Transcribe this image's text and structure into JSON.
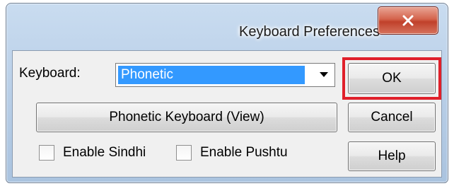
{
  "window": {
    "title": "Keyboard Preferences"
  },
  "keyboard": {
    "label": "Keyboard:",
    "selected": "Phonetic"
  },
  "buttons": {
    "ok": "OK",
    "phonetic_view": "Phonetic Keyboard (View)",
    "cancel": "Cancel",
    "help": "Help"
  },
  "options": {
    "sindhi": {
      "label": "Enable Sindhi",
      "checked": false
    },
    "pushtu": {
      "label": "Enable Pushtu",
      "checked": false
    }
  },
  "colors": {
    "highlight_border": "#e0202a",
    "selection": "#3399ff",
    "close_button": "#c0402a"
  }
}
